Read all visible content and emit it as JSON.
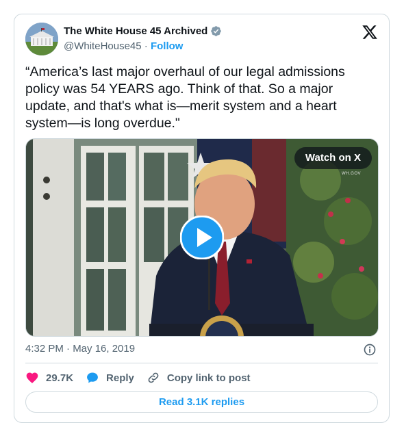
{
  "tweet": {
    "author_name": "The White House 45 Archived",
    "handle": "@WhiteHouse45",
    "separator": "·",
    "follow_label": "Follow",
    "text": "“America’s last major overhaul of our legal admissions policy was 54 YEARS ago. Think of that. So a major update, and that's what is—merit system and a heart system—is long overdue.\"",
    "timestamp": "4:32 PM · May 16, 2019"
  },
  "media": {
    "watch_label": "Watch on X",
    "watermark": "WH.GOV"
  },
  "actions": {
    "likes_count": "29.7K",
    "reply_label": "Reply",
    "copy_label": "Copy link to post"
  },
  "footer": {
    "read_replies_label": "Read 3.1K replies"
  },
  "colors": {
    "accent": "#1d9bf0",
    "like": "#f91880",
    "text": "#0f1419",
    "muted": "#536471",
    "border": "#cfd9de"
  },
  "icons": {
    "verified": "verified-badge-icon",
    "brand": "x-logo-icon",
    "play": "play-icon",
    "info": "info-icon",
    "like": "heart-icon",
    "reply": "reply-bubble-icon",
    "copy": "link-icon"
  }
}
